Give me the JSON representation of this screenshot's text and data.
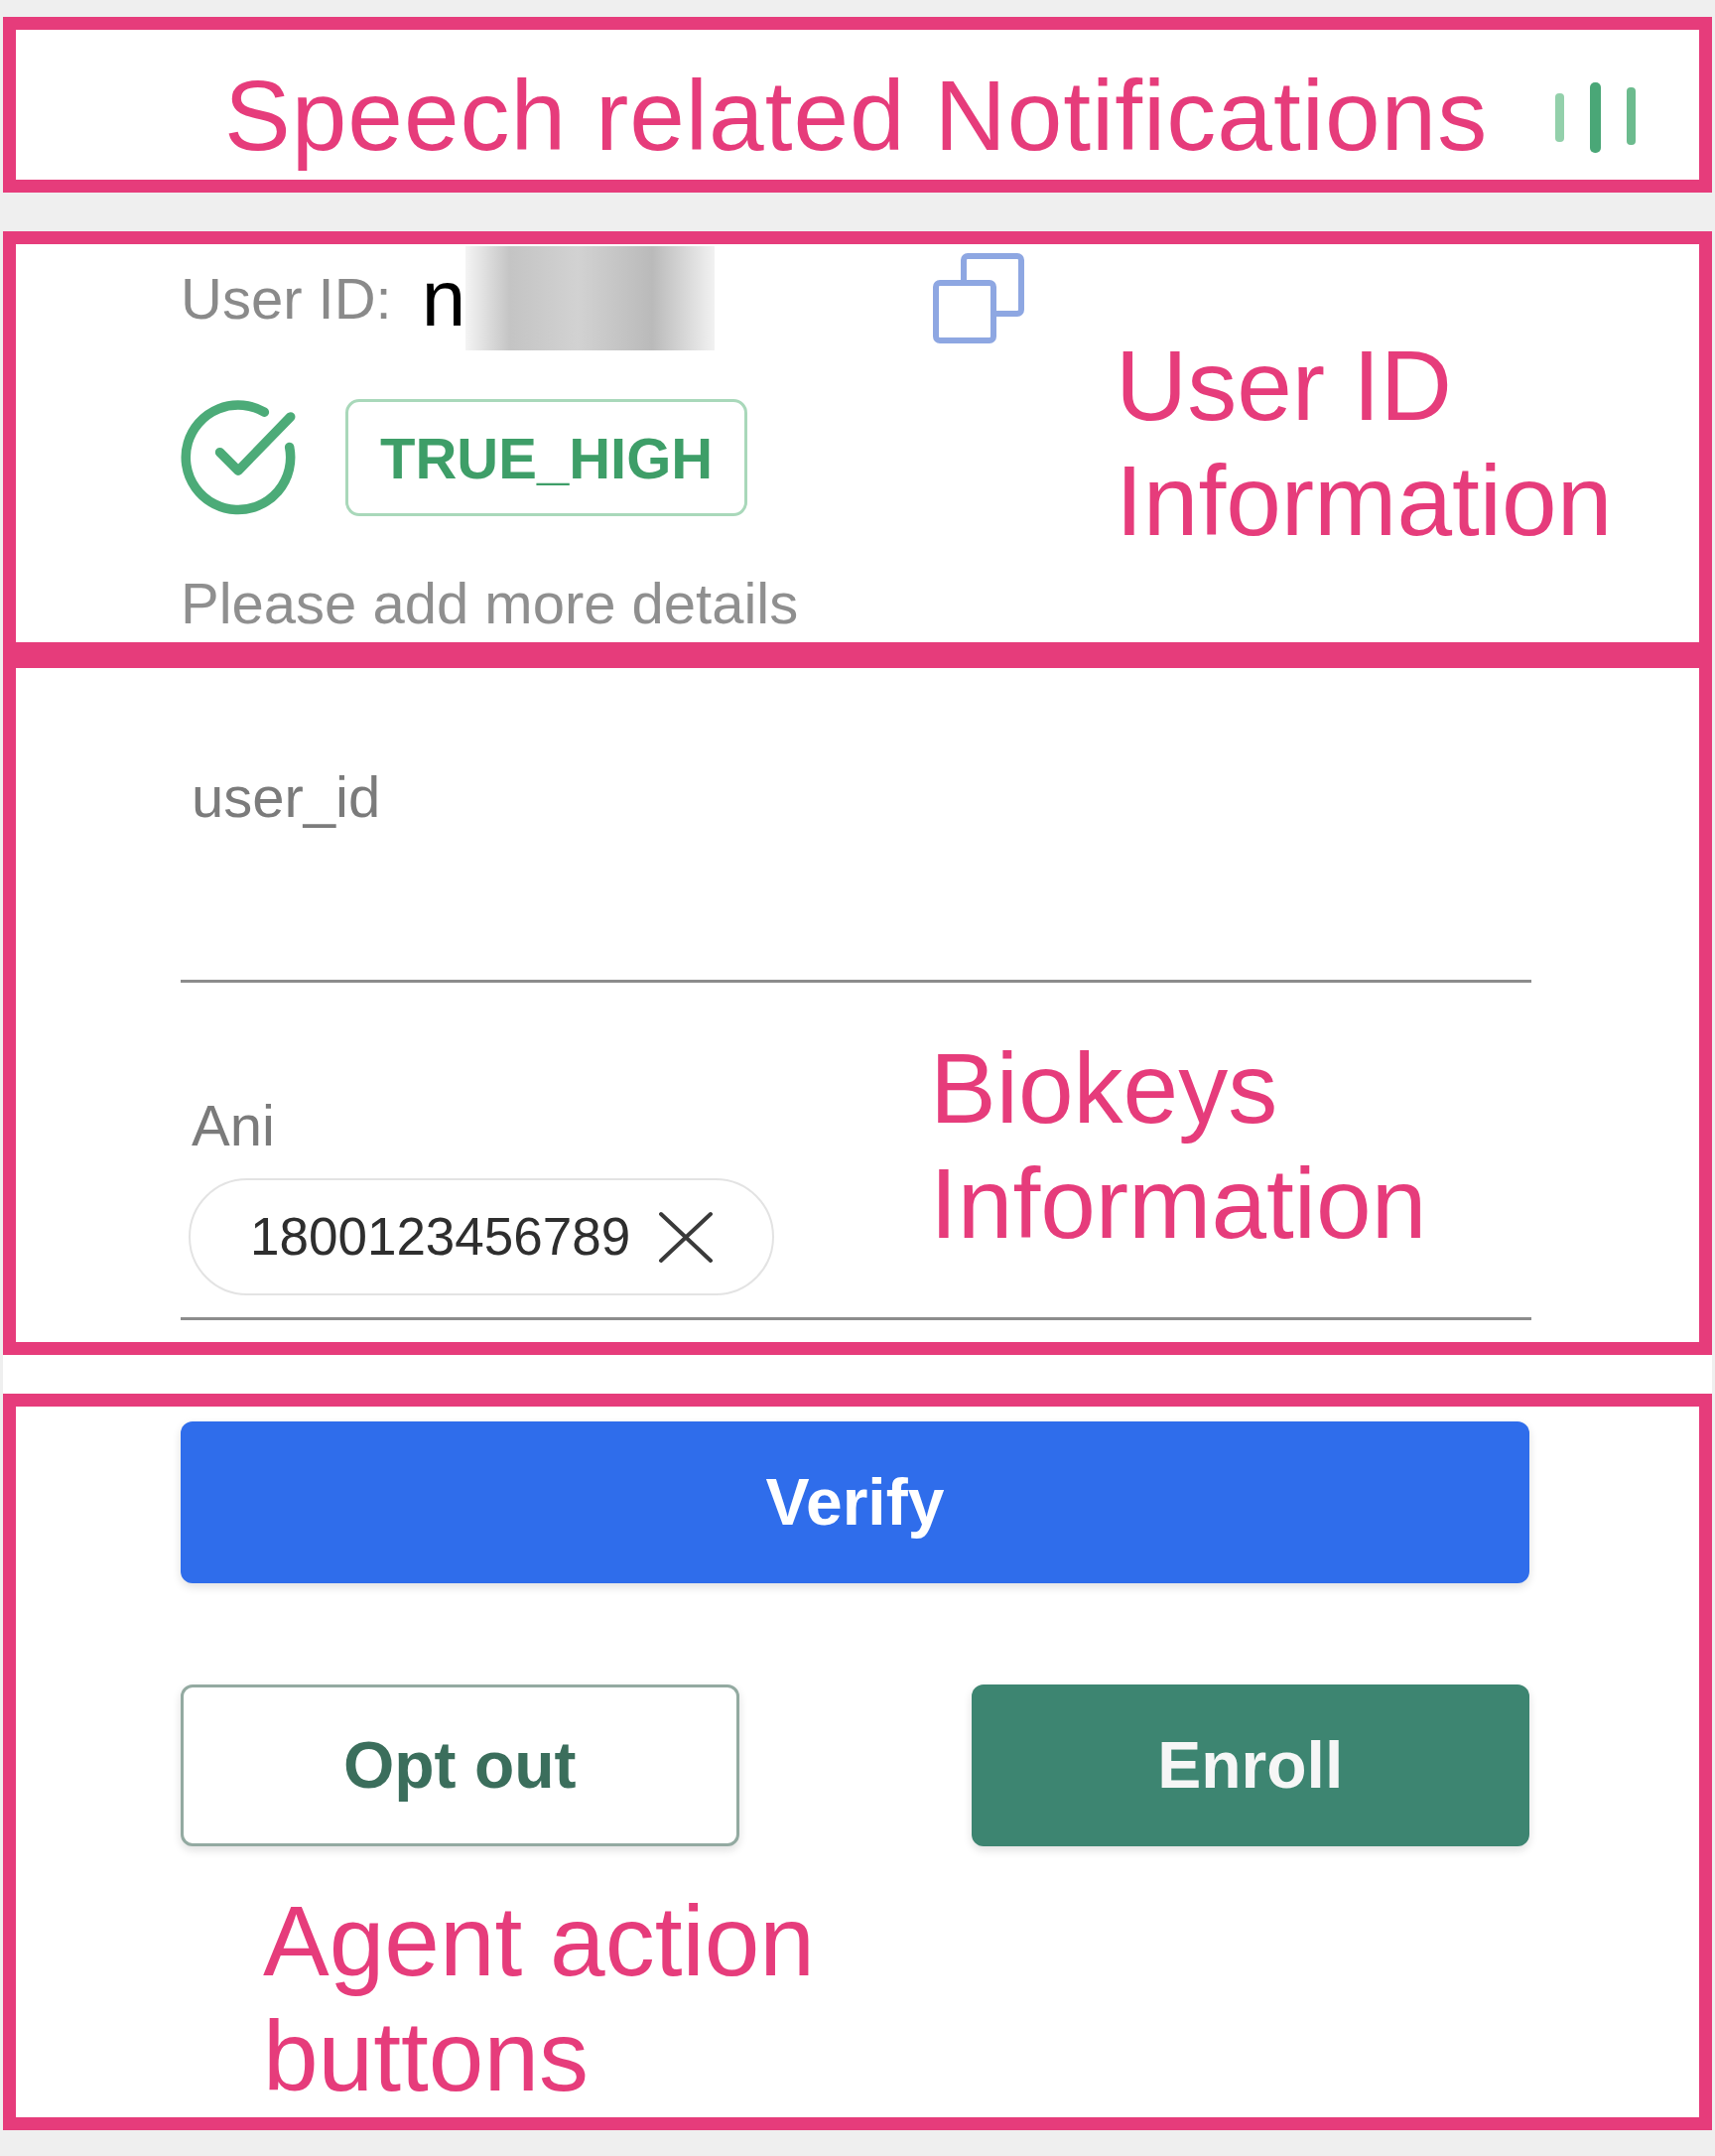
{
  "notifications": {
    "annotation": "Speech related Notifications"
  },
  "user_info": {
    "label": "User ID:",
    "value": "n",
    "verified": true,
    "status": "TRUE_HIGH",
    "message": "Please add more details",
    "annotation": "User ID Information"
  },
  "biokeys": {
    "fields": [
      {
        "label": "user_id",
        "kind": "text"
      },
      {
        "label": "Ani",
        "kind": "chips",
        "chips": [
          "1800123456789"
        ]
      }
    ],
    "annotation": "Biokeys Information"
  },
  "actions": {
    "buttons": [
      {
        "label": "Verify",
        "kind": "primary"
      },
      {
        "label": "Opt out",
        "kind": "outline"
      },
      {
        "label": "Enroll",
        "kind": "success"
      }
    ],
    "annotation": "Agent action buttons"
  }
}
